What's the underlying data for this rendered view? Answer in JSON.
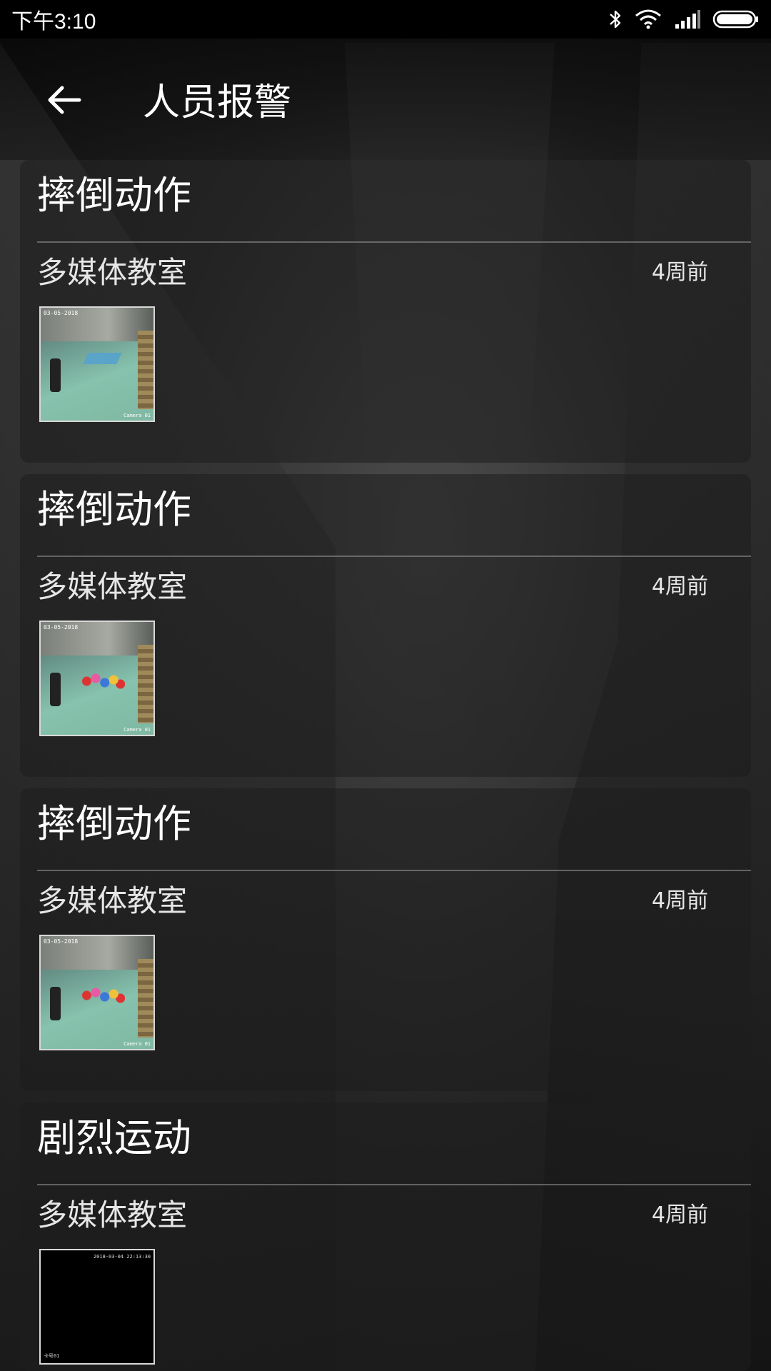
{
  "status_bar": {
    "time": "下午3:10",
    "icons": [
      "bluetooth-icon",
      "wifi-icon",
      "signal-icon",
      "battery-icon"
    ]
  },
  "header": {
    "back_icon": "arrow-left-icon",
    "title": "人员报警"
  },
  "alerts": [
    {
      "type": "摔倒动作",
      "location": "多媒体教室",
      "time_ago": "4周前",
      "thumbnail": {
        "kind": "classroom",
        "stamp": "03-05-2018",
        "camera": "Camera 01"
      }
    },
    {
      "type": "摔倒动作",
      "location": "多媒体教室",
      "time_ago": "4周前",
      "thumbnail": {
        "kind": "classroom",
        "stamp": "03-05-2018",
        "camera": "Camera 01"
      }
    },
    {
      "type": "摔倒动作",
      "location": "多媒体教室",
      "time_ago": "4周前",
      "thumbnail": {
        "kind": "classroom",
        "stamp": "03-05-2018",
        "camera": "Camera 01"
      }
    },
    {
      "type": "剧烈运动",
      "location": "多媒体教室",
      "time_ago": "4周前",
      "thumbnail": {
        "kind": "dark",
        "stamp": "2018-03-04 22:13:30",
        "camera": "卡号01"
      }
    }
  ]
}
